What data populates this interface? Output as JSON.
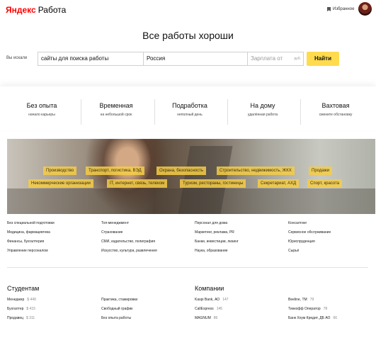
{
  "header": {
    "logo_brand": "Яндекс",
    "logo_product": "Работа",
    "favorites_label": "Избранное"
  },
  "page_title": "Все работы хороши",
  "search": {
    "label": "Вы искали",
    "query_value": "сайты для поиска работы",
    "region_value": "Россия",
    "salary_placeholder": "Зарплата от",
    "salary_unit": "руб.",
    "find_label": "Найти"
  },
  "job_types": [
    {
      "title": "Без опыта",
      "subtitle": "начало карьеры"
    },
    {
      "title": "Временная",
      "subtitle": "на небольшой срок"
    },
    {
      "title": "Подработка",
      "subtitle": "неполный день"
    },
    {
      "title": "На дому",
      "subtitle": "удалённая работа"
    },
    {
      "title": "Вахтовая",
      "subtitle": "смените обстановку"
    }
  ],
  "banner_chips": [
    "Производство",
    "Транспорт, логистика, ВЭД",
    "Охрана, безопасность",
    "Строительство, недвижимость, ЖКХ",
    "Продажи",
    "Некоммерческие организации",
    "IT, интернет, связь, телеком",
    "Туризм, рестораны, гостиницы",
    "Секретариат, АХД",
    "Спорт, красота"
  ],
  "categories": [
    [
      "Без специальной подготовки",
      "Медицина, фармацевтика",
      "Финансы, бухгалтерия",
      "Управление персоналом"
    ],
    [
      "Топ-менеджмент",
      "Страхование",
      "СМИ, издательство, полиграфия",
      "Искусство, культура, развлечения"
    ],
    [
      "Персонал для дома",
      "Маркетинг, реклама, PR",
      "Банки, инвестиции, лизинг",
      "Наука, образование"
    ],
    [
      "Консалтинг",
      "Сервисное обслуживание",
      "Юриспруденция",
      "Сырьё"
    ]
  ],
  "students": {
    "title": "Студентам",
    "col1": [
      {
        "label": "Менеджер",
        "value": "$ 449"
      },
      {
        "label": "Бухгалтер",
        "value": "$ 415"
      },
      {
        "label": "Продавец",
        "value": "$ 311"
      }
    ],
    "col2": [
      {
        "label": "Практика, стажировки"
      },
      {
        "label": "Свободный график"
      },
      {
        "label": "Без опыта работы"
      }
    ]
  },
  "companies": {
    "title": "Компании",
    "col1": [
      {
        "label": "Kaspi Bank, АО",
        "value": "147"
      },
      {
        "label": "CallExpress",
        "value": "145"
      },
      {
        "label": "MAGNUM",
        "value": "86"
      }
    ],
    "col2": [
      {
        "label": "Beeline, ТМ",
        "value": "79"
      },
      {
        "label": "Тинкофф Оператор",
        "value": "78"
      },
      {
        "label": "Банк Хоум Кредит, ДБ АО",
        "value": "66"
      }
    ]
  }
}
